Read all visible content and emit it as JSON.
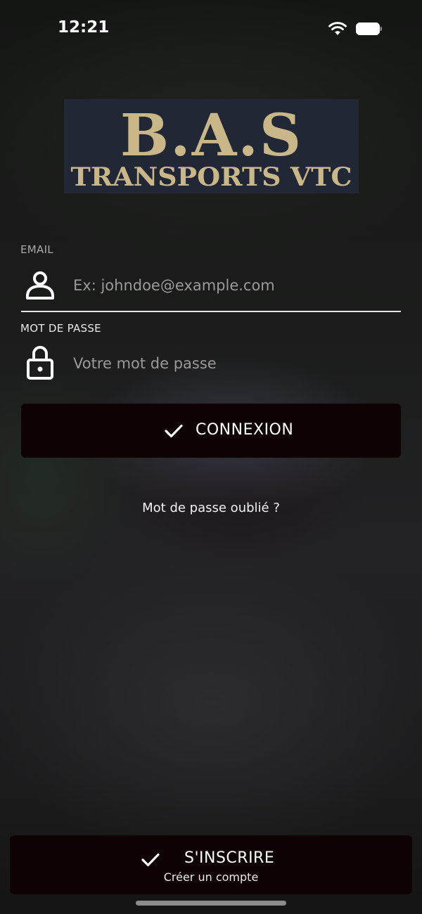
{
  "status_bar": {
    "time": "12:21",
    "wifi_icon": "wifi-icon",
    "battery_icon": "battery-icon"
  },
  "logo": {
    "line1": "B.A.S",
    "line2": "TRANSPORTS VTC",
    "background_color": "#222735",
    "text_color": "#c9b78a"
  },
  "form": {
    "email": {
      "label": "EMAIL",
      "placeholder": "Ex: johndoe@example.com",
      "value": "",
      "icon": "user-icon"
    },
    "password": {
      "label": "MOT DE PASSE",
      "placeholder": "Votre mot de passe",
      "value": "",
      "icon": "lock-icon"
    },
    "login_button": {
      "label": "CONNEXION",
      "icon": "check-icon"
    },
    "forgot_password": "Mot de passe oublié ?"
  },
  "signup": {
    "label": "S'INSCRIRE",
    "sublabel": "Créer un compte",
    "icon": "check-icon"
  },
  "colors": {
    "button_background": "#0e0203",
    "text": "#ffffff",
    "placeholder": "#9a9a9a"
  }
}
